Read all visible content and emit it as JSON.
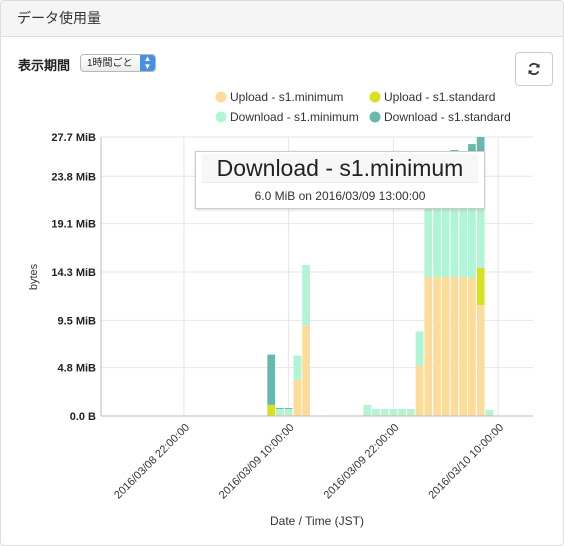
{
  "panel": {
    "title": "データ使用量"
  },
  "controls": {
    "period_label": "表示期間",
    "period_value": "1時間ごと",
    "refresh_icon": "refresh-icon"
  },
  "colors": {
    "upload_minimum": "#fcdc9a",
    "upload_standard": "#d7e11e",
    "download_minimum": "#b0f5d6",
    "download_standard": "#67b8ad"
  },
  "tooltip": {
    "title": "Download - s1.minimum",
    "value": "6.0 MiB on 2016/03/09 13:00:00"
  },
  "chart_data": {
    "type": "bar",
    "stacked": true,
    "xlabel": "Date / Time (JST)",
    "ylabel": "bytes",
    "yticks": [
      "0.0 B",
      "4.8 MiB",
      "9.5 MiB",
      "14.3 MiB",
      "19.1 MiB",
      "23.8 MiB",
      "27.7 MiB"
    ],
    "ytick_values": [
      0,
      4.8,
      9.5,
      14.3,
      19.1,
      23.8,
      27.7
    ],
    "ylim": [
      0,
      27.7
    ],
    "xticks": [
      "2016/03/08 22:00:00",
      "2016/03/09 10:00:00",
      "2016/03/09 22:00:00",
      "2016/03/10 10:00:00"
    ],
    "xtick_hours": [
      0,
      12,
      24,
      36
    ],
    "xlim_hours": [
      -9.5,
      40
    ],
    "start": "2016/03/08 22:00:00",
    "grid": true,
    "legend_position": "top",
    "series_names": [
      "Upload - s1.minimum",
      "Upload - s1.standard",
      "Download - s1.minimum",
      "Download - s1.standard"
    ],
    "bars": [
      {
        "hour": 10,
        "values": [
          0,
          1.1,
          0,
          5.0
        ]
      },
      {
        "hour": 11,
        "values": [
          0.1,
          0,
          0.6,
          0.1
        ]
      },
      {
        "hour": 12,
        "values": [
          0.1,
          0,
          0.6,
          0.1
        ]
      },
      {
        "hour": 13,
        "values": [
          3.6,
          0,
          2.4,
          0
        ]
      },
      {
        "hour": 14,
        "values": [
          9.0,
          0,
          6.0,
          0
        ]
      },
      {
        "hour": 21,
        "values": [
          0.1,
          0,
          1.0,
          0
        ]
      },
      {
        "hour": 22,
        "values": [
          0.1,
          0,
          0.6,
          0
        ]
      },
      {
        "hour": 23,
        "values": [
          0.1,
          0,
          0.6,
          0
        ]
      },
      {
        "hour": 24,
        "values": [
          0.1,
          0,
          0.6,
          0
        ]
      },
      {
        "hour": 25,
        "values": [
          0.1,
          0,
          0.6,
          0
        ]
      },
      {
        "hour": 26,
        "values": [
          0.1,
          0,
          0.6,
          0
        ]
      },
      {
        "hour": 27,
        "values": [
          5.0,
          0,
          3.4,
          0
        ]
      },
      {
        "hour": 28,
        "values": [
          13.8,
          0,
          12.5,
          0
        ]
      },
      {
        "hour": 29,
        "values": [
          13.8,
          0,
          12.2,
          0
        ]
      },
      {
        "hour": 30,
        "values": [
          13.8,
          0,
          12.0,
          0
        ]
      },
      {
        "hour": 31,
        "values": [
          13.8,
          0,
          12.3,
          0.3
        ]
      },
      {
        "hour": 32,
        "values": [
          13.8,
          0,
          12.0,
          0.4
        ]
      },
      {
        "hour": 33,
        "values": [
          13.7,
          0,
          12.5,
          0.8
        ]
      },
      {
        "hour": 34,
        "values": [
          11.0,
          3.7,
          11.5,
          1.5
        ]
      },
      {
        "hour": 35,
        "values": [
          0.1,
          0,
          0.5,
          0
        ]
      }
    ]
  }
}
